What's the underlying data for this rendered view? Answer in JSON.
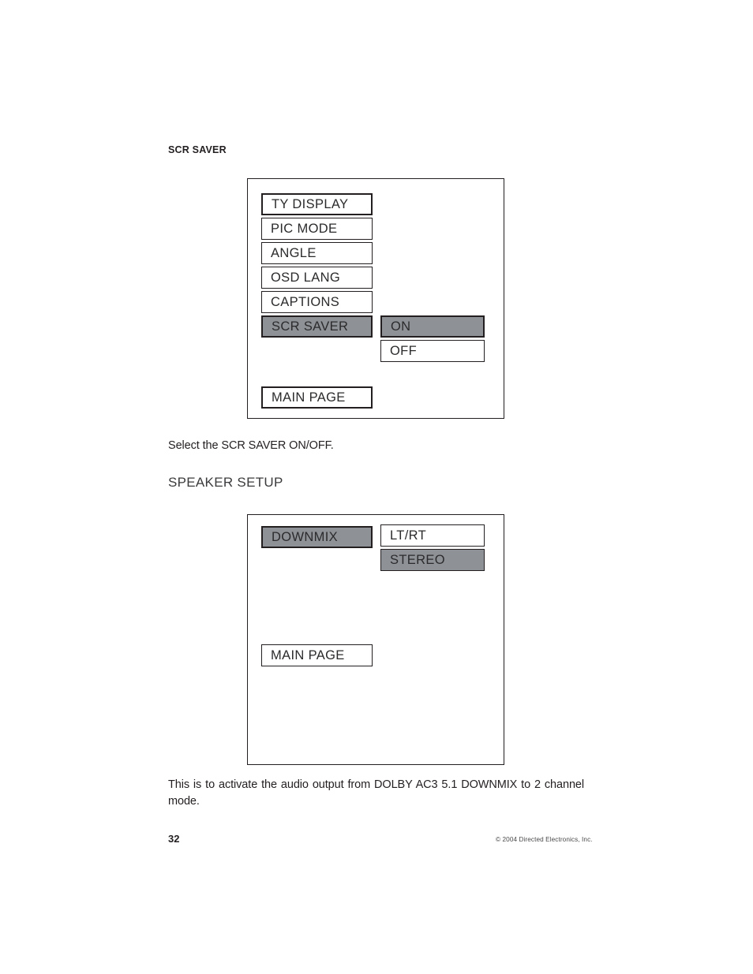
{
  "document": {
    "page_number": "32",
    "copyright": "© 2004 Directed Electronics, Inc."
  },
  "sections": [
    {
      "heading": "SCR SAVER",
      "caption": "Select the SCR SAVER ON/OFF.",
      "osd": {
        "left_column": [
          {
            "label": "TY DISPLAY",
            "selected": false,
            "emphasized": true
          },
          {
            "label": "PIC MODE",
            "selected": false,
            "emphasized": false
          },
          {
            "label": "ANGLE",
            "selected": false,
            "emphasized": false
          },
          {
            "label": "OSD LANG",
            "selected": false,
            "emphasized": false
          },
          {
            "label": "CAPTIONS",
            "selected": false,
            "emphasized": false
          },
          {
            "label": "SCR SAVER",
            "selected": true,
            "emphasized": true
          }
        ],
        "right_column": [
          {
            "label": "ON",
            "selected": true,
            "emphasized": true
          },
          {
            "label": "OFF",
            "selected": false,
            "emphasized": false
          }
        ],
        "footer_button": {
          "label": "MAIN PAGE",
          "selected": false,
          "emphasized": true
        }
      }
    },
    {
      "heading": "SPEAKER SETUP",
      "caption": "This is to activate the audio output from DOLBY AC3 5.1 DOWNMIX to 2 channel mode.",
      "osd": {
        "left_column": [
          {
            "label": "DOWNMIX",
            "selected": true,
            "emphasized": true
          }
        ],
        "right_column": [
          {
            "label": "LT/RT",
            "selected": false,
            "emphasized": false
          },
          {
            "label": "STEREO",
            "selected": true,
            "emphasized": false
          }
        ],
        "footer_button": {
          "label": "MAIN PAGE",
          "selected": false,
          "emphasized": false
        }
      }
    }
  ],
  "colors": {
    "ink": "#231f20",
    "highlight": "#8e9195",
    "heading_gray": "#3b3b3d"
  }
}
